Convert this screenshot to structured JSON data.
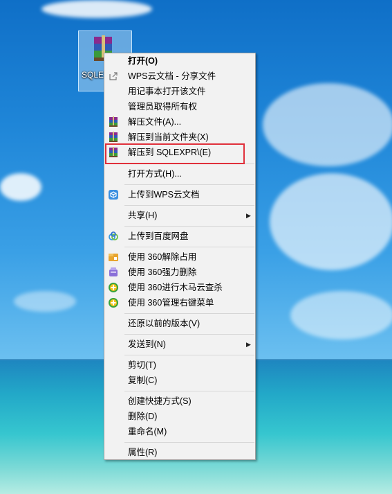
{
  "desktop": {
    "file_label": "SQLEX"
  },
  "menu": {
    "items": [
      {
        "label": "打开(O)",
        "icon": "none"
      },
      {
        "label": "WPS云文档 - 分享文件",
        "icon": "share-icon"
      },
      {
        "label": "用记事本打开该文件",
        "icon": "none"
      },
      {
        "label": "管理员取得所有权",
        "icon": "none"
      },
      {
        "label": "解压文件(A)...",
        "icon": "winrar-icon"
      },
      {
        "label": "解压到当前文件夹(X)",
        "icon": "winrar-icon"
      },
      {
        "label": "解压到 SQLEXPR\\(E)",
        "icon": "winrar-icon"
      },
      {
        "label": "打开方式(H)...",
        "icon": "none"
      },
      {
        "label": "上传到WPS云文档",
        "icon": "wps-cloud-icon"
      },
      {
        "label": "共享(H)",
        "icon": "none"
      },
      {
        "label": "上传到百度网盘",
        "icon": "baidu-cloud-icon"
      },
      {
        "label": "使用 360解除占用",
        "icon": "360-unlock-icon"
      },
      {
        "label": "使用 360强力删除",
        "icon": "360-delete-icon"
      },
      {
        "label": "使用 360进行木马云查杀",
        "icon": "360-scan-icon"
      },
      {
        "label": "使用 360管理右键菜单",
        "icon": "360-menu-icon"
      },
      {
        "label": "还原以前的版本(V)",
        "icon": "none"
      },
      {
        "label": "发送到(N)",
        "icon": "none"
      },
      {
        "label": "剪切(T)",
        "icon": "none"
      },
      {
        "label": "复制(C)",
        "icon": "none"
      },
      {
        "label": "创建快捷方式(S)",
        "icon": "none"
      },
      {
        "label": "删除(D)",
        "icon": "none"
      },
      {
        "label": "重命名(M)",
        "icon": "none"
      },
      {
        "label": "属性(R)",
        "icon": "none"
      }
    ]
  },
  "colors": {
    "highlight_border": "#e0303b",
    "menu_bg": "#f2f2f2"
  }
}
